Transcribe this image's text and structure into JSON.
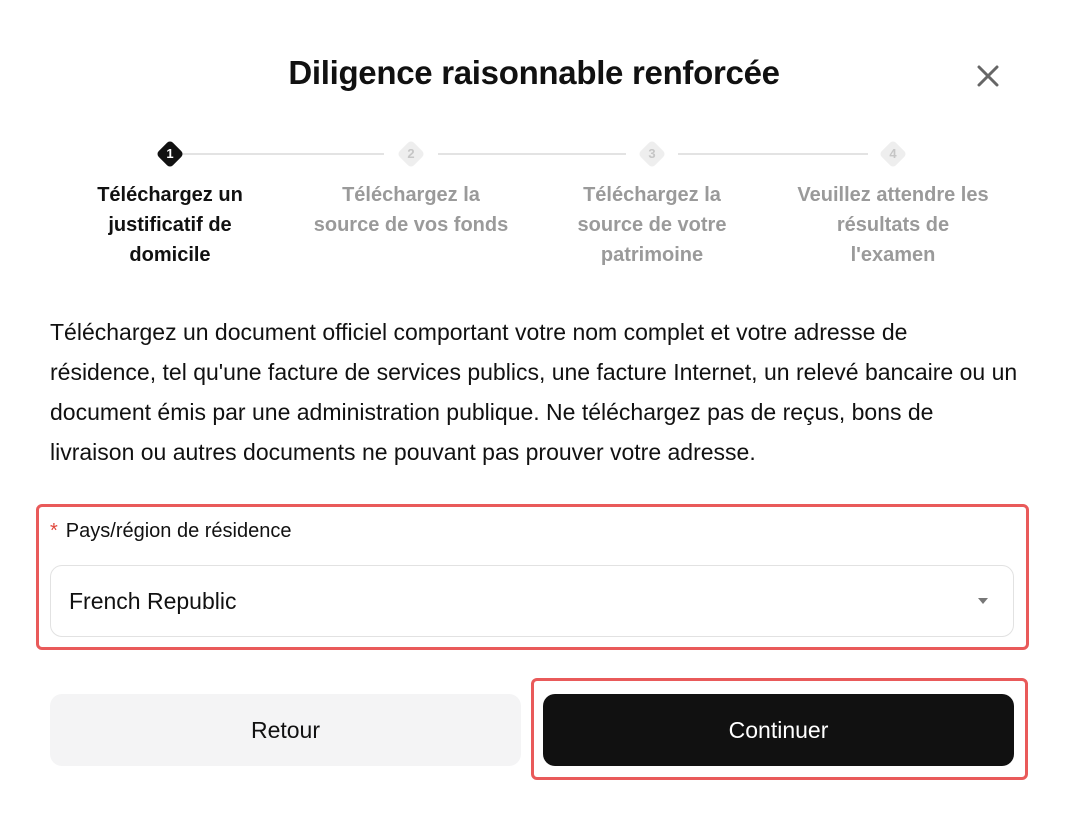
{
  "dialog": {
    "title": "Diligence raisonnable renforcée",
    "close_icon": "close-icon"
  },
  "stepper": {
    "current_step": 1,
    "steps": [
      {
        "number": "1",
        "label": "Téléchargez un justificatif de domicile",
        "state": "active"
      },
      {
        "number": "2",
        "label": "Téléchargez la source de vos fonds",
        "state": "inactive"
      },
      {
        "number": "3",
        "label": "Téléchargez la source de votre patrimoine",
        "state": "inactive"
      },
      {
        "number": "4",
        "label": "Veuillez attendre les résultats de l'examen",
        "state": "inactive"
      }
    ]
  },
  "description": "Téléchargez un document officiel comportant votre nom complet et votre adresse de résidence, tel qu'une facture de services publics, une facture Internet, un relevé bancaire ou un document émis par une administration publique. Ne téléchargez pas de reçus, bons de livraison ou autres documents ne pouvant pas prouver votre adresse.",
  "country_field": {
    "required_marker": "*",
    "label": "Pays/région de résidence",
    "value": "French Republic",
    "caret_icon": "caret-down-icon"
  },
  "actions": {
    "back_label": "Retour",
    "continue_label": "Continuer"
  },
  "colors": {
    "primary": "#111111",
    "highlight": "#e95a5a",
    "required": "#e0473c",
    "inactive_text": "#9a9a9a"
  }
}
